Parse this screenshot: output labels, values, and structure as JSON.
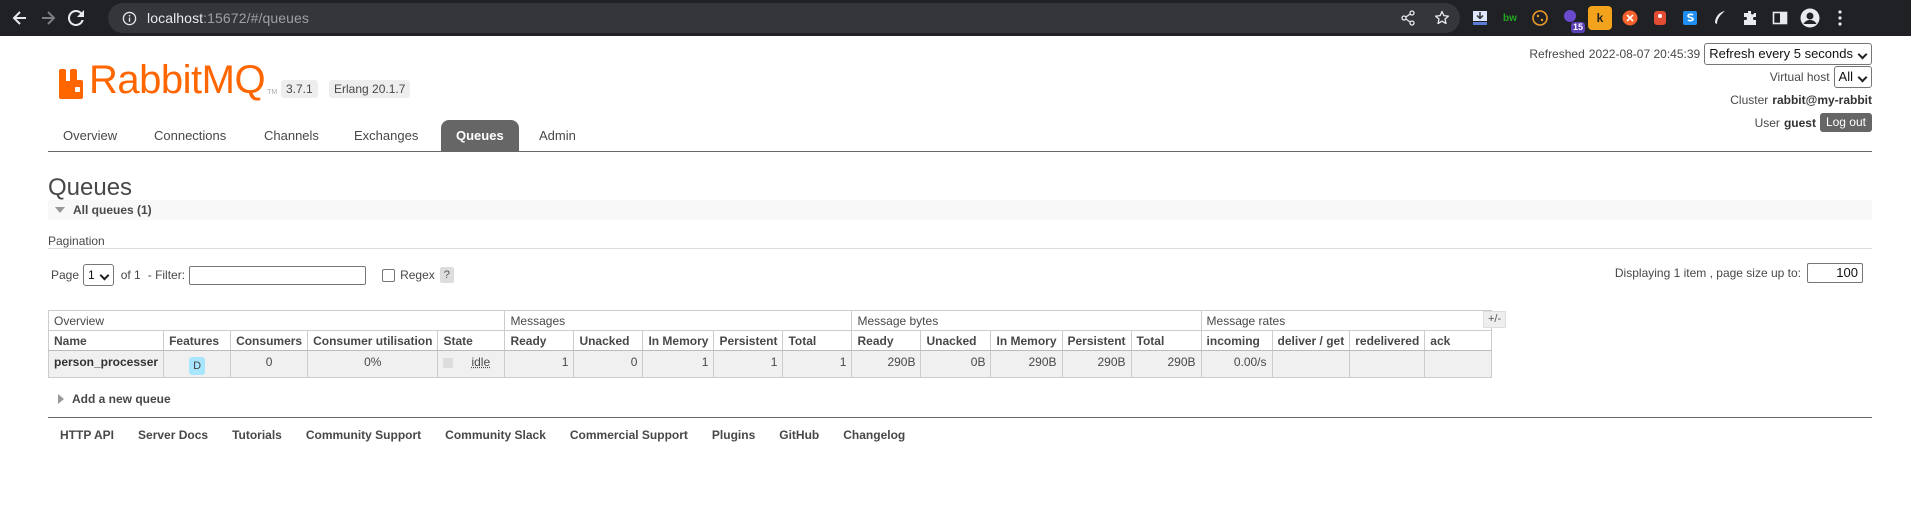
{
  "browser": {
    "url_host": "localhost",
    "url_rest": ":15672/#/queues",
    "ext_badge": "15",
    "ext_k": "k"
  },
  "header": {
    "logo_text": "RabbitMQ",
    "logo_tm": "TM",
    "version": "3.7.1",
    "erlang": "Erlang 20.1.7",
    "refreshed_label": "Refreshed",
    "refreshed_time": "2022-08-07 20:45:39",
    "refresh_select": "Refresh every 5 seconds",
    "vhost_label": "Virtual host",
    "vhost_select": "All",
    "cluster_label": "Cluster",
    "cluster_value": "rabbit@my-rabbit",
    "user_label": "User",
    "user_value": "guest",
    "logout_label": "Log out"
  },
  "tabs": [
    {
      "label": "Overview"
    },
    {
      "label": "Connections"
    },
    {
      "label": "Channels"
    },
    {
      "label": "Exchanges"
    },
    {
      "label": "Queues",
      "active": true
    },
    {
      "label": "Admin"
    }
  ],
  "page": {
    "title": "Queues",
    "section_title": "All queues (1)",
    "pagination_label": "Pagination",
    "page_label": "Page",
    "page_select": "1",
    "of_label": "of 1",
    "filter_label": "- Filter:",
    "filter_value": "",
    "regex_label": "Regex",
    "help": "?",
    "displaying": "Displaying 1 item , page size up to:",
    "page_size": "100",
    "plusminus": "+/-",
    "add_queue": "Add a new queue"
  },
  "table": {
    "groups": [
      "Overview",
      "Messages",
      "Message bytes",
      "Message rates"
    ],
    "columns": [
      "Name",
      "Features",
      "Consumers",
      "Consumer utilisation",
      "State",
      "Ready",
      "Unacked",
      "In Memory",
      "Persistent",
      "Total",
      "Ready",
      "Unacked",
      "In Memory",
      "Persistent",
      "Total",
      "incoming",
      "deliver / get",
      "redelivered",
      "ack"
    ],
    "rows": [
      {
        "name": "person_processer",
        "feature": "D",
        "consumers": "0",
        "utilisation": "0%",
        "state": "idle",
        "msg_ready": "1",
        "msg_unacked": "0",
        "msg_memory": "1",
        "msg_persistent": "1",
        "msg_total": "1",
        "bytes_ready": "290B",
        "bytes_unacked": "0B",
        "bytes_memory": "290B",
        "bytes_persistent": "290B",
        "bytes_total": "290B",
        "rate_incoming": "0.00/s",
        "rate_deliver": "",
        "rate_redelivered": "",
        "rate_ack": ""
      }
    ]
  },
  "footer": [
    "HTTP API",
    "Server Docs",
    "Tutorials",
    "Community Support",
    "Community Slack",
    "Commercial Support",
    "Plugins",
    "GitHub",
    "Changelog"
  ]
}
